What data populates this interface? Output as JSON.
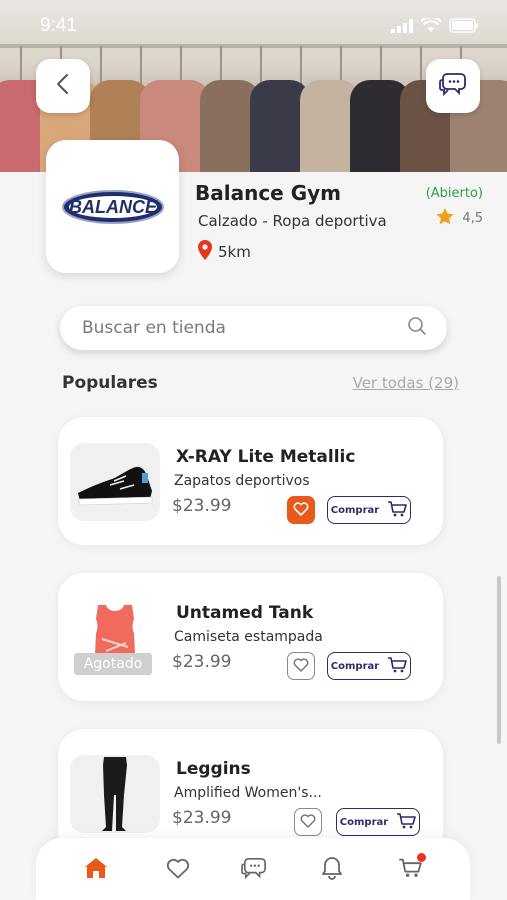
{
  "status": {
    "time": "9:41"
  },
  "store": {
    "logo_text": "BALANCE",
    "name": "Balance Gym",
    "category": "Calzado - Ropa deportiva",
    "distance": "5km",
    "open_status": "(Abierto)",
    "rating": "4,5"
  },
  "search": {
    "placeholder": "Buscar en tienda"
  },
  "popular": {
    "title": "Populares",
    "see_all": "Ver todas (29)"
  },
  "products": [
    {
      "title": "X-RAY Lite Metallic",
      "subtitle": "Zapatos deportivos",
      "price": "$23.99",
      "buy_label": "Comprar",
      "favorite": true
    },
    {
      "title": "Untamed Tank",
      "subtitle": "Camiseta estampada",
      "price": "$23.99",
      "buy_label": "Comprar",
      "favorite": false,
      "badge": "Agotado"
    },
    {
      "title": "Leggins",
      "subtitle": "Amplified Women's...",
      "price": "$23.99",
      "buy_label": "Comprar",
      "favorite": false
    }
  ],
  "tabbar": {
    "items": [
      "home-icon",
      "heart-icon",
      "chat-icon",
      "bell-icon",
      "cart-icon"
    ],
    "active": "home-icon"
  },
  "colors": {
    "accent": "#e8591a",
    "primary": "#2c2c6c",
    "open": "#2e9e47",
    "star": "#f0a01e",
    "pin": "#e8341a"
  }
}
